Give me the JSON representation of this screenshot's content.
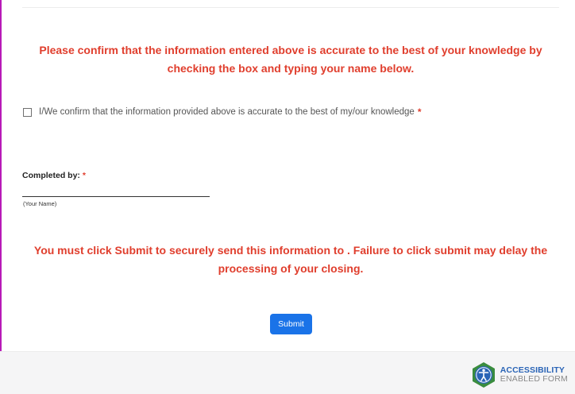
{
  "notices": {
    "top": "Please confirm that the information entered above is accurate to the best of your knowledge by checking the box and typing your name below.",
    "bottom": "You must click Submit to securely send this information to .  Failure to click submit may delay the processing of your closing."
  },
  "confirmation": {
    "label": "I/We confirm that the information provided above is accurate to the best of my/our knowledge",
    "required_mark": "*",
    "checked": false
  },
  "completed_by": {
    "label": "Completed by:",
    "required_mark": "*",
    "value": "",
    "hint": "(Your Name)"
  },
  "submit": {
    "label": "Submit"
  },
  "footer": {
    "badge_line1": "ACCESSIBILITY",
    "badge_line2": "ENABLED FORM",
    "badge_icon": "accessibility-person-icon"
  },
  "colors": {
    "notice": "#e03e2d",
    "submit_bg": "#1a73e8",
    "badge_blue": "#2a64b6",
    "badge_green": "#3a8c3f",
    "left_accent": "#b81ab8"
  }
}
